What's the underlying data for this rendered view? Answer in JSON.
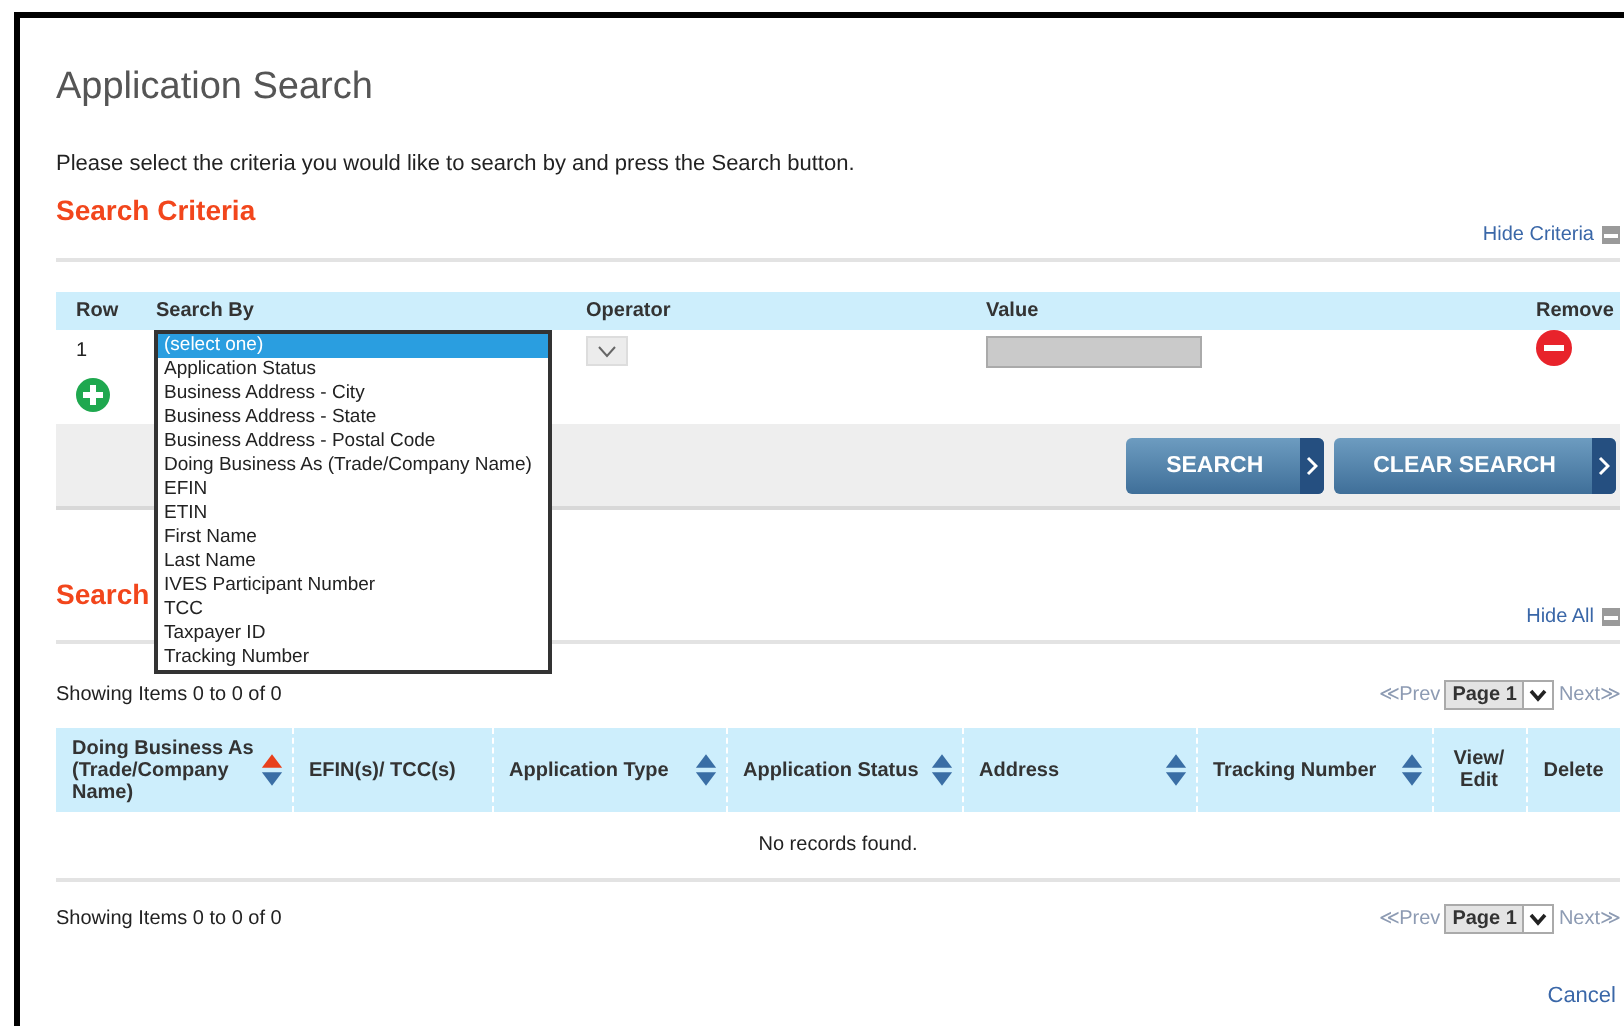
{
  "page": {
    "title": "Application Search",
    "instructions": "Please select the criteria you would like to search by and press the Search button."
  },
  "criteria": {
    "heading": "Search Criteria",
    "toggle": "Hide Criteria",
    "columns": [
      "Row",
      "Search By",
      "Operator",
      "Value",
      "Remove"
    ],
    "rows": [
      {
        "row": "1",
        "search_by": {
          "expanded": true,
          "options": [
            {
              "label": "(select one)",
              "selected": true
            },
            {
              "label": "Application Status",
              "selected": false
            },
            {
              "label": "Business Address - City",
              "selected": false
            },
            {
              "label": "Business Address - State",
              "selected": false
            },
            {
              "label": "Business Address - Postal Code",
              "selected": false
            },
            {
              "label": "Doing Business As (Trade/Company Name)",
              "selected": false
            },
            {
              "label": "EFIN",
              "selected": false
            },
            {
              "label": "ETIN",
              "selected": false
            },
            {
              "label": "First Name",
              "selected": false
            },
            {
              "label": "Last Name",
              "selected": false
            },
            {
              "label": "IVES Participant Number",
              "selected": false
            },
            {
              "label": "TCC",
              "selected": false
            },
            {
              "label": "Taxpayer ID",
              "selected": false
            },
            {
              "label": "Tracking Number",
              "selected": false
            }
          ]
        },
        "operator": {
          "disabled": true
        },
        "value": {
          "disabled": true
        }
      }
    ],
    "buttons": [
      "SEARCH",
      "CLEAR SEARCH"
    ]
  },
  "results": {
    "heading": "Search",
    "toggle": "Hide All",
    "summary_top": "Showing Items 0 to 0 of 0",
    "pager_top": {
      "prev": "≪Prev",
      "page": "Page 1",
      "next": "Next≫",
      "prev_disabled": true,
      "next_disabled": true
    },
    "columns": [
      {
        "label": "Doing Business As (Trade/Company Name)",
        "sortable": true,
        "sorted_ascending": true
      },
      {
        "label": "EFIN(s)/ TCC(s)",
        "sortable": false
      },
      {
        "label": "Application Type",
        "sortable": true,
        "sorted_ascending": false
      },
      {
        "label": "Application Status",
        "sortable": true,
        "sorted_ascending": false
      },
      {
        "label": "Address",
        "sortable": true,
        "sorted_ascending": false
      },
      {
        "label": "Tracking Number",
        "sortable": true,
        "sorted_ascending": false
      },
      {
        "label": "View/ Edit",
        "sortable": false
      },
      {
        "label": "Delete",
        "sortable": false
      }
    ],
    "empty_message": "No records found.",
    "summary_bottom": "Showing Items 0 to 0 of 0",
    "pager_bottom": {
      "prev": "≪Prev",
      "page": "Page 1",
      "next": "Next≫",
      "prev_disabled": true,
      "next_disabled": true
    }
  },
  "cancel": "Cancel"
}
